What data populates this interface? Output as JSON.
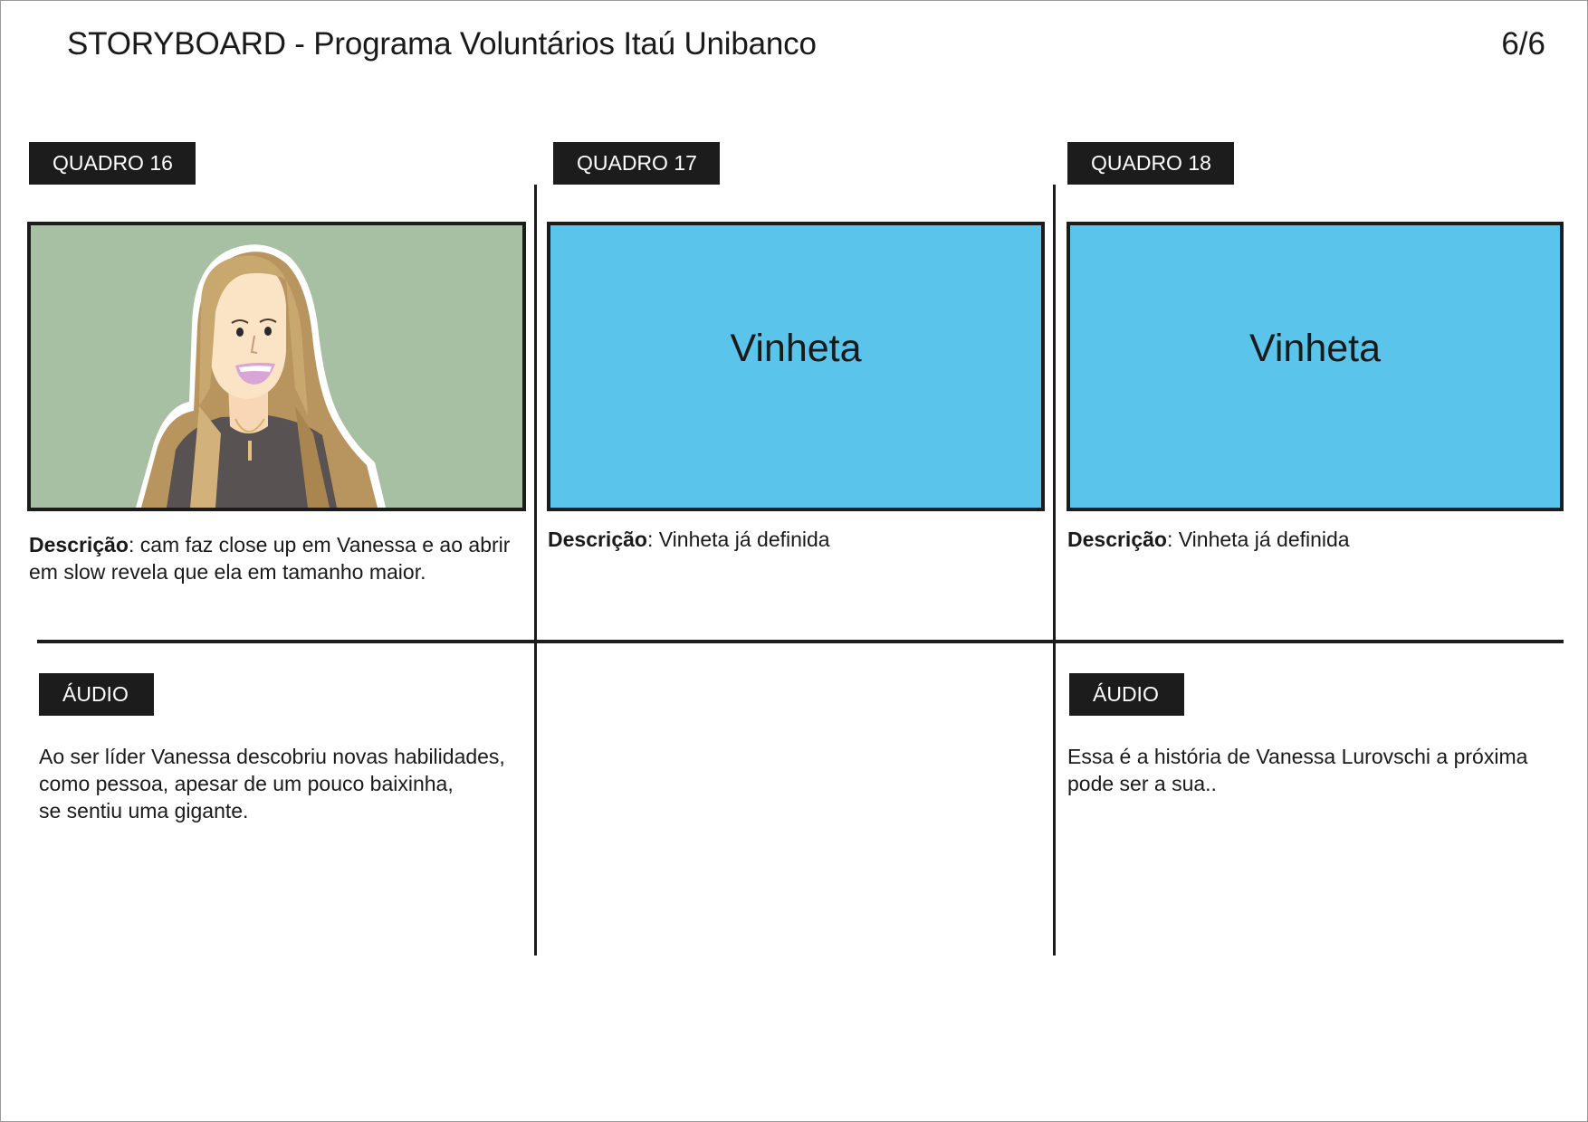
{
  "header": {
    "title": "STORYBOARD - Programa Voluntários Itaú Unibanco",
    "page": "6/6"
  },
  "colors": {
    "vignette_blue": "#5bc4eb",
    "frame_background_green": "#a7bfa2",
    "tag_black": "#1c1c1c"
  },
  "frames": [
    {
      "tag": "QUADRO 16",
      "image": "illustration-woman-long-hair-smiling",
      "desc_label": "Descrição",
      "desc_text": ": cam faz close up em Vanessa e ao abrir em slow revela que ela em tamanho maior.",
      "audio_tag": "ÁUDIO",
      "audio_text": "Ao ser líder Vanessa descobriu novas habilidades,\ncomo pessoa, apesar de um pouco baixinha,\nse sentiu uma gigante."
    },
    {
      "tag": "QUADRO 17",
      "frame_text": "Vinheta",
      "desc_label": "Descrição",
      "desc_text": ": Vinheta já definida"
    },
    {
      "tag": "QUADRO 18",
      "frame_text": "Vinheta",
      "desc_label": "Descrição",
      "desc_text": ": Vinheta já definida",
      "audio_tag": "ÁUDIO",
      "audio_text": "Essa é a história de Vanessa Lurovschi a próxima\npode ser a sua.."
    }
  ]
}
